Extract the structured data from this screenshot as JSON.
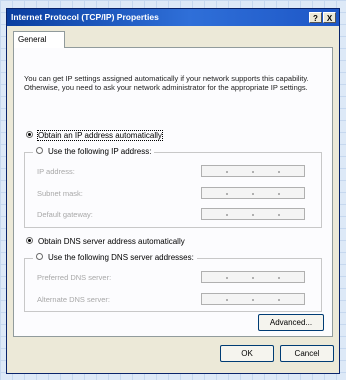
{
  "window": {
    "title": "Internet Protocol (TCP/IP) Properties",
    "help_label": "?",
    "close_label": "X"
  },
  "tabs": [
    {
      "label": "General"
    }
  ],
  "intro_text": "You can get IP settings assigned automatically if your network supports this capability. Otherwise, you need to ask your network administrator for the appropriate IP settings.",
  "ip_options": [
    {
      "label": "Obtain an IP address automatically",
      "selected": true
    },
    {
      "label": "Use the following IP address:",
      "selected": false
    }
  ],
  "ip_fields": [
    {
      "label": "IP address:",
      "value": ""
    },
    {
      "label": "Subnet mask:",
      "value": ""
    },
    {
      "label": "Default gateway:",
      "value": ""
    }
  ],
  "dns_options": [
    {
      "label": "Obtain DNS server address automatically",
      "selected": true
    },
    {
      "label": "Use the following DNS server addresses:",
      "selected": false
    }
  ],
  "dns_fields": [
    {
      "label": "Preferred DNS server:",
      "value": ""
    },
    {
      "label": "Alternate DNS server:",
      "value": ""
    }
  ],
  "buttons": {
    "advanced": "Advanced...",
    "ok": "OK",
    "cancel": "Cancel"
  },
  "colors": {
    "titlebar": "#0a3ea0",
    "dialog_bg": "#ece9d8",
    "panel_bg": "#fcfcfe"
  }
}
